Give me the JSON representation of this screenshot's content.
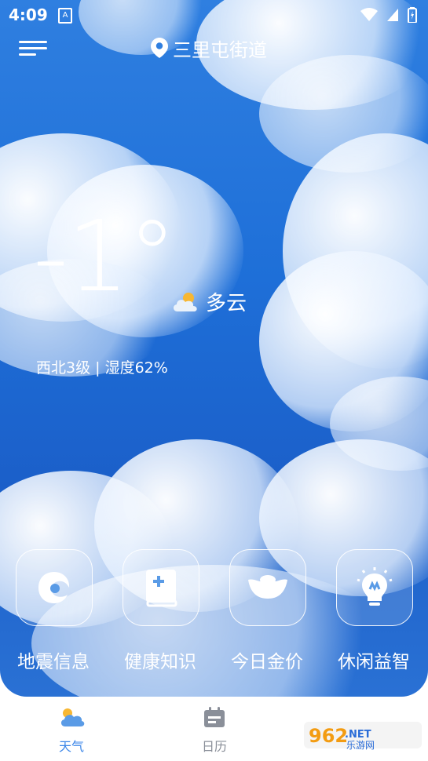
{
  "status_bar": {
    "time": "4:09",
    "sim_label": "A"
  },
  "header": {
    "menu_icon": "menu-icon",
    "location_icon": "location-pin-icon",
    "location": "三里屯街道"
  },
  "weather": {
    "temperature": "-1°",
    "condition": "多云",
    "condition_icon": "partly-cloudy-icon",
    "details": "西北3级 | 湿度62%"
  },
  "features": [
    {
      "label": "地震信息",
      "icon": "cyclone-icon"
    },
    {
      "label": "健康知识",
      "icon": "health-book-icon"
    },
    {
      "label": "今日金价",
      "icon": "gold-ingot-icon"
    },
    {
      "label": "休闲益智",
      "icon": "lightbulb-icon"
    }
  ],
  "bottom_nav": {
    "items": [
      {
        "label": "天气",
        "icon": "weather-tab-icon",
        "active": true
      },
      {
        "label": "日历",
        "icon": "calendar-tab-icon",
        "active": false
      }
    ]
  },
  "watermark": {
    "text": "962.NET",
    "subtext": "乐游网"
  },
  "colors": {
    "active_tab": "#3b86e8",
    "inactive_tab": "#8a8f99",
    "sky": "#1e6fd8"
  }
}
